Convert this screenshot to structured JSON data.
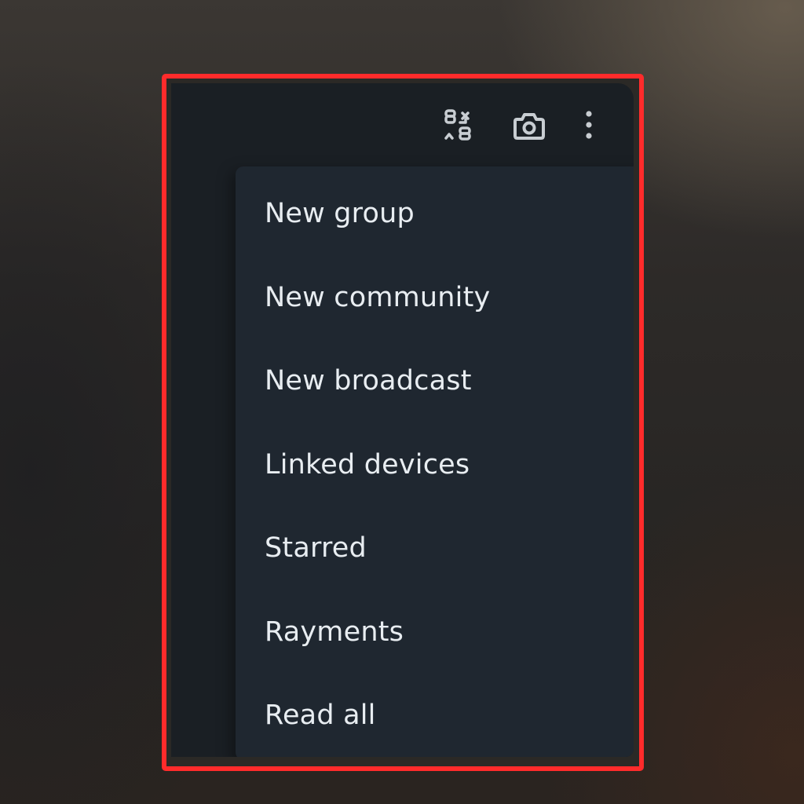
{
  "toolbar": {
    "icons": [
      "qr-scan-icon",
      "camera-icon",
      "more-options-icon"
    ]
  },
  "menu": {
    "items": [
      {
        "label": "New group"
      },
      {
        "label": "New community"
      },
      {
        "label": "New broadcast"
      },
      {
        "label": "Linked devices"
      },
      {
        "label": "Starred"
      },
      {
        "label": "Rayments"
      },
      {
        "label": "Read all"
      }
    ]
  },
  "colors": {
    "highlight_border": "#ff2b2b",
    "app_background": "#1a1f24",
    "menu_background": "#1f2730",
    "menu_text": "#e8edf1",
    "icon_color": "#c8cdd2"
  }
}
